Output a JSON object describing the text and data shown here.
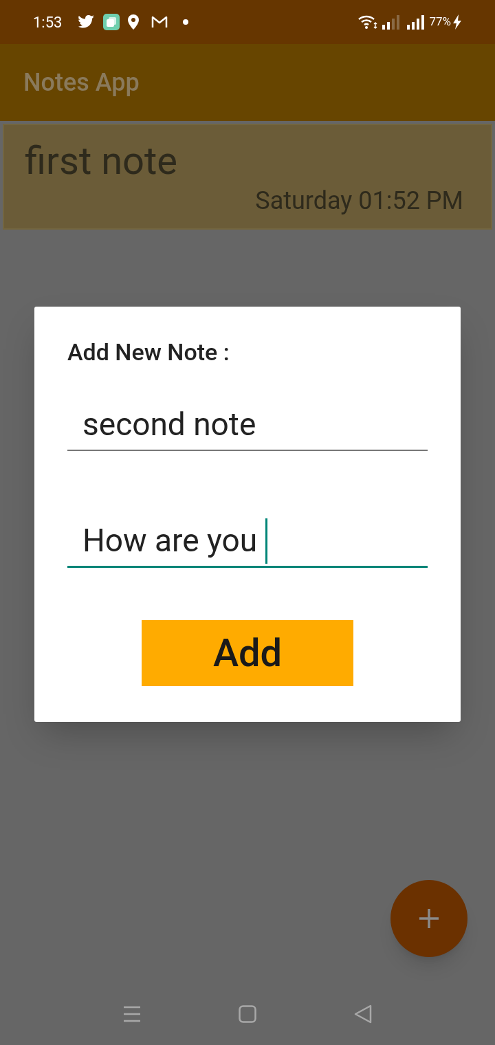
{
  "status_bar": {
    "time": "1:53",
    "battery": "77%"
  },
  "app_bar": {
    "title": "Notes App"
  },
  "notes": [
    {
      "title": "first note",
      "date": "Saturday 01:52 PM"
    }
  ],
  "dialog": {
    "title": "Add New Note :",
    "fields": [
      {
        "value": "second note",
        "focused": false
      },
      {
        "value": "How are you",
        "focused": true
      }
    ],
    "button": "Add"
  }
}
